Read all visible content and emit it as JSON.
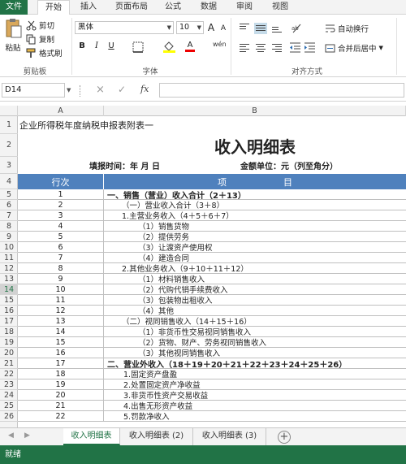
{
  "ribbon_tabs": [
    "文件",
    "开始",
    "插入",
    "页面布局",
    "公式",
    "数据",
    "审阅",
    "视图"
  ],
  "ribbon": {
    "paste": "粘贴",
    "cut": "剪切",
    "copy": "复制",
    "format_painter": "格式刷",
    "clipboard_group": "剪贴板",
    "font_name": "黑体",
    "font_size": "10",
    "bold": "B",
    "italic": "I",
    "underline": "U",
    "font_grow": "A",
    "font_shrink": "A",
    "font_color_letter": "A",
    "wen": "wén",
    "font_group": "字体",
    "wrap_text": "自动换行",
    "merge_center": "合并后居中",
    "align_group": "对齐方式"
  },
  "formula_bar": {
    "name_box": "D14",
    "cancel": "×",
    "confirm": "✓",
    "fx": "fx",
    "value": ""
  },
  "columns": [
    "A",
    "B"
  ],
  "title_row": {
    "label": "企业所得税年度纳税申报表附表一"
  },
  "main_title": "收入明细表",
  "fill_time": "填报时间：年    月    日",
  "amount_unit": "金额单位：元（列至角分）",
  "table_header": {
    "col_a": "行次",
    "col_b": "项                    目"
  },
  "rows": [
    {
      "r": "1",
      "a": "",
      "b": "企业所得税年度纳税申报表附表一"
    },
    {
      "r": "2",
      "a": "",
      "b": ""
    },
    {
      "r": "3",
      "a": "",
      "b": ""
    },
    {
      "r": "4",
      "a": "行次",
      "b": "项目"
    },
    {
      "r": "5",
      "a": "1",
      "b": "一、销售（营业）收入合计（2＋13）"
    },
    {
      "r": "6",
      "a": "2",
      "b": "（一）营业收入合计（3＋8）"
    },
    {
      "r": "7",
      "a": "3",
      "b": "1.主营业务收入（4＋5＋6＋7）"
    },
    {
      "r": "8",
      "a": "4",
      "b": "（1）销售货物"
    },
    {
      "r": "9",
      "a": "5",
      "b": "（2）提供劳务"
    },
    {
      "r": "10",
      "a": "6",
      "b": "（3）让渡资产使用权"
    },
    {
      "r": "11",
      "a": "7",
      "b": "（4）建造合同"
    },
    {
      "r": "12",
      "a": "8",
      "b": "2.其他业务收入（9＋10＋11＋12）"
    },
    {
      "r": "13",
      "a": "9",
      "b": "（1）材料销售收入"
    },
    {
      "r": "14",
      "a": "10",
      "b": "（2）代购代销手续费收入"
    },
    {
      "r": "15",
      "a": "11",
      "b": "（3）包装物出租收入"
    },
    {
      "r": "16",
      "a": "12",
      "b": "（4）其他"
    },
    {
      "r": "17",
      "a": "13",
      "b": "（二）视同销售收入（14＋15＋16）"
    },
    {
      "r": "18",
      "a": "14",
      "b": "（1）非货币性交易视同销售收入"
    },
    {
      "r": "19",
      "a": "15",
      "b": "（2）货物、财产、劳务视同销售收入"
    },
    {
      "r": "20",
      "a": "16",
      "b": "（3）其他视同销售收入"
    },
    {
      "r": "21",
      "a": "17",
      "b": "二、营业外收入（18＋19＋20＋21＋22＋23＋24＋25＋26）"
    },
    {
      "r": "22",
      "a": "18",
      "b": "1.固定资产盘盈"
    },
    {
      "r": "23",
      "a": "19",
      "b": "2.处置固定资产净收益"
    },
    {
      "r": "24",
      "a": "20",
      "b": "3.非货币性资产交易收益"
    },
    {
      "r": "25",
      "a": "21",
      "b": "4.出售无形资产收益"
    },
    {
      "r": "26",
      "a": "22",
      "b": "5.罚款净收入"
    }
  ],
  "sheet_tabs": [
    "收入明细表",
    "收入明细表 (2)",
    "收入明细表 (3)"
  ],
  "add_sheet": "+",
  "status": "就绪",
  "colors": {
    "excel_green": "#217346",
    "header_blue": "#4f81bd"
  }
}
